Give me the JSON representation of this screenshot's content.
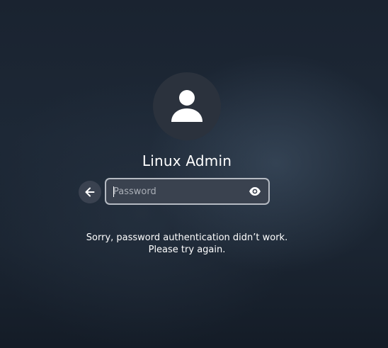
{
  "user": {
    "display_name": "Linux Admin",
    "avatar_icon": "user-silhouette-icon"
  },
  "login": {
    "back_icon": "arrow-left-icon",
    "password_placeholder": "Password",
    "password_value": "",
    "reveal_icon": "eye-icon"
  },
  "message": {
    "line1": "Sorry, password authentication didn’t work.",
    "line2": "Please try again."
  },
  "colors": {
    "background": "#1d2836",
    "avatar_bg": "#2b323d",
    "entry_bg": "#3a424f",
    "entry_border": "#b5bac2",
    "back_button_bg": "#3a4250",
    "text": "#ffffff"
  }
}
